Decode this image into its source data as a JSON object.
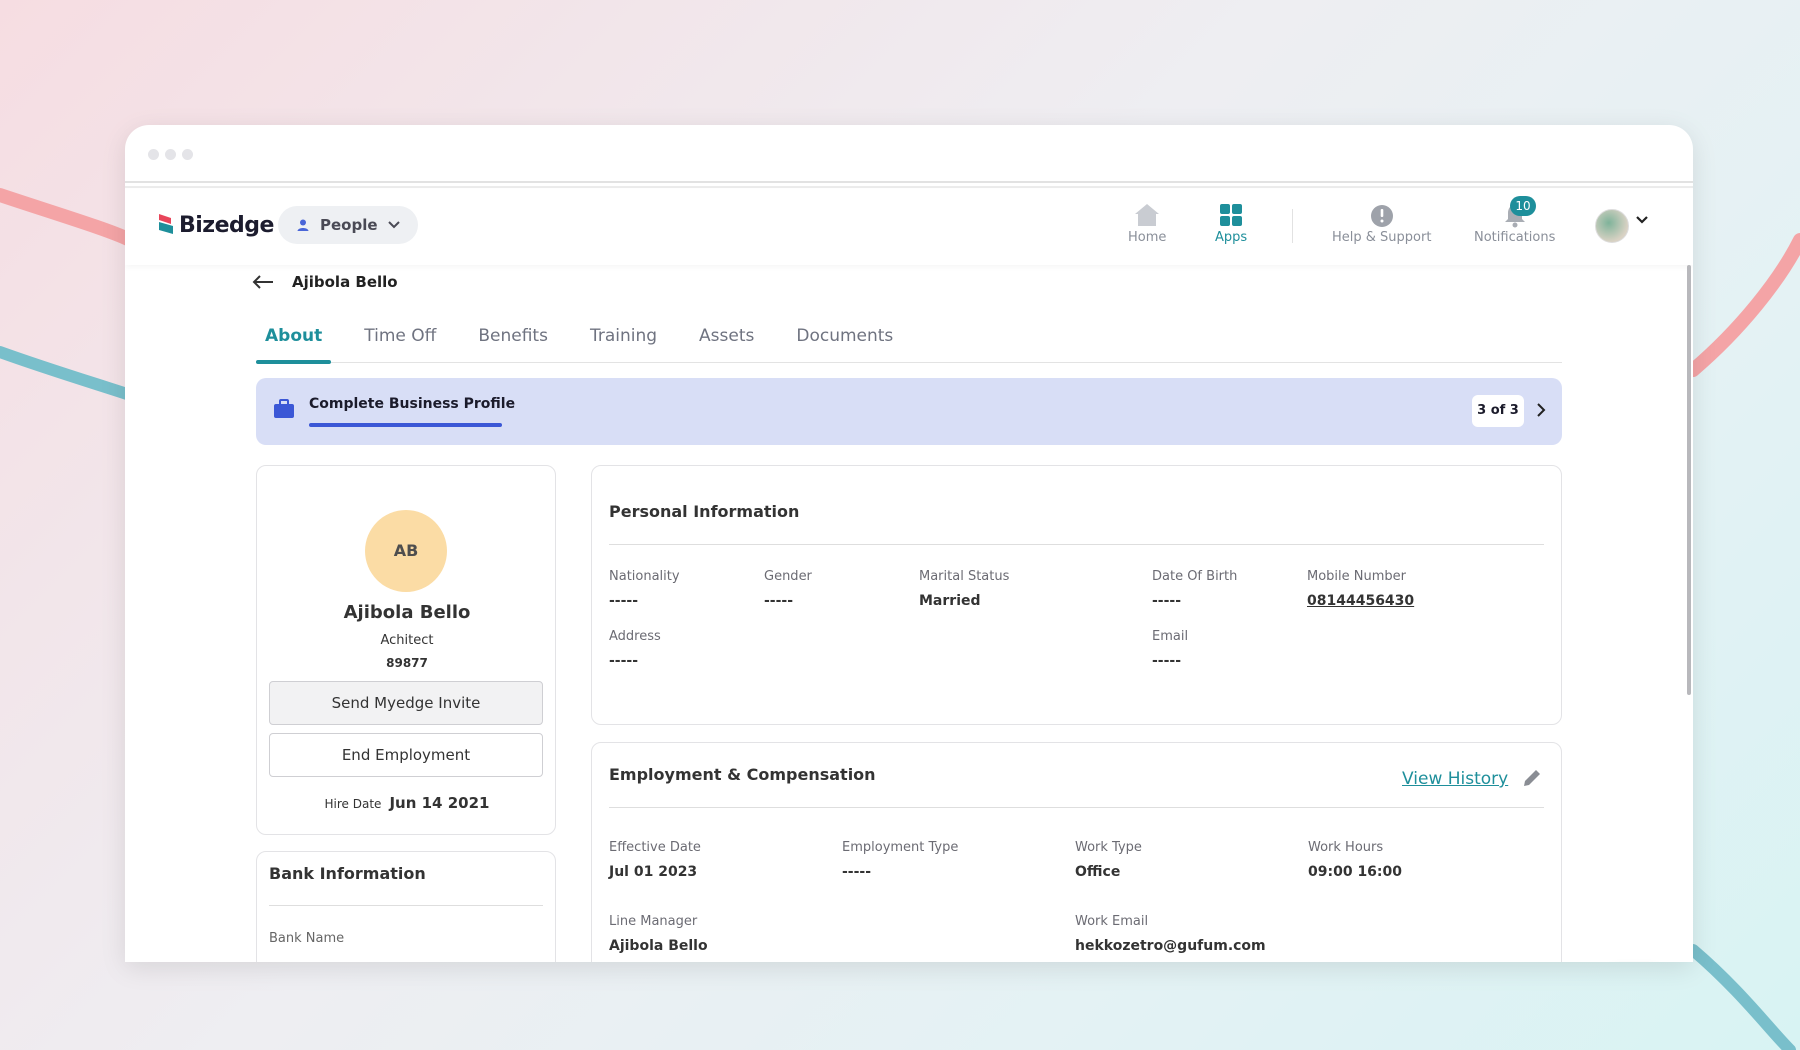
{
  "brand": {
    "name": "Bizedge",
    "accent": "#1e8f9b"
  },
  "topnav": {
    "module": "People",
    "items": [
      {
        "label": "Home",
        "icon": "home-icon"
      },
      {
        "label": "Apps",
        "icon": "apps-grid-icon",
        "active": true
      },
      {
        "label": "Help & Support",
        "icon": "info-icon"
      },
      {
        "label": "Notifications",
        "icon": "bell-icon",
        "badge": "10"
      }
    ]
  },
  "header": {
    "employee_name": "Ajibola Bello"
  },
  "tabs": [
    "About",
    "Time Off",
    "Benefits",
    "Training",
    "Assets",
    "Documents"
  ],
  "banner": {
    "title": "Complete Business Profile",
    "count": "3 of 3"
  },
  "profile": {
    "initials": "AB",
    "name": "Ajibola Bello",
    "role": "Achitect",
    "employee_id": "89877",
    "invite_label": "Send Myedge Invite",
    "end_label": "End Employment",
    "hire_label": "Hire Date",
    "hire_date": "Jun 14 2021"
  },
  "bank": {
    "title": "Bank Information",
    "bank_name_label": "Bank Name"
  },
  "personal": {
    "title": "Personal Information",
    "nationality_label": "Nationality",
    "nationality": "-----",
    "gender_label": "Gender",
    "gender": "-----",
    "marital_label": "Marital Status",
    "marital": "Married",
    "dob_label": "Date Of Birth",
    "dob": "-----",
    "mobile_label": "Mobile Number",
    "mobile": "08144456430",
    "address_label": "Address",
    "address": "-----",
    "email_label": "Email",
    "email": "-----"
  },
  "employment": {
    "title": "Employment & Compensation",
    "view_history": "View History",
    "effective_label": "Effective Date",
    "effective": "Jul 01 2023",
    "type_label": "Employment Type",
    "type": "-----",
    "worktype_label": "Work Type",
    "worktype": "Office",
    "hours_label": "Work Hours",
    "hours": "09:00 16:00",
    "manager_label": "Line Manager",
    "manager": "Ajibola Bello",
    "workemail_label": "Work Email",
    "workemail": "hekkozetro@gufum.com"
  }
}
